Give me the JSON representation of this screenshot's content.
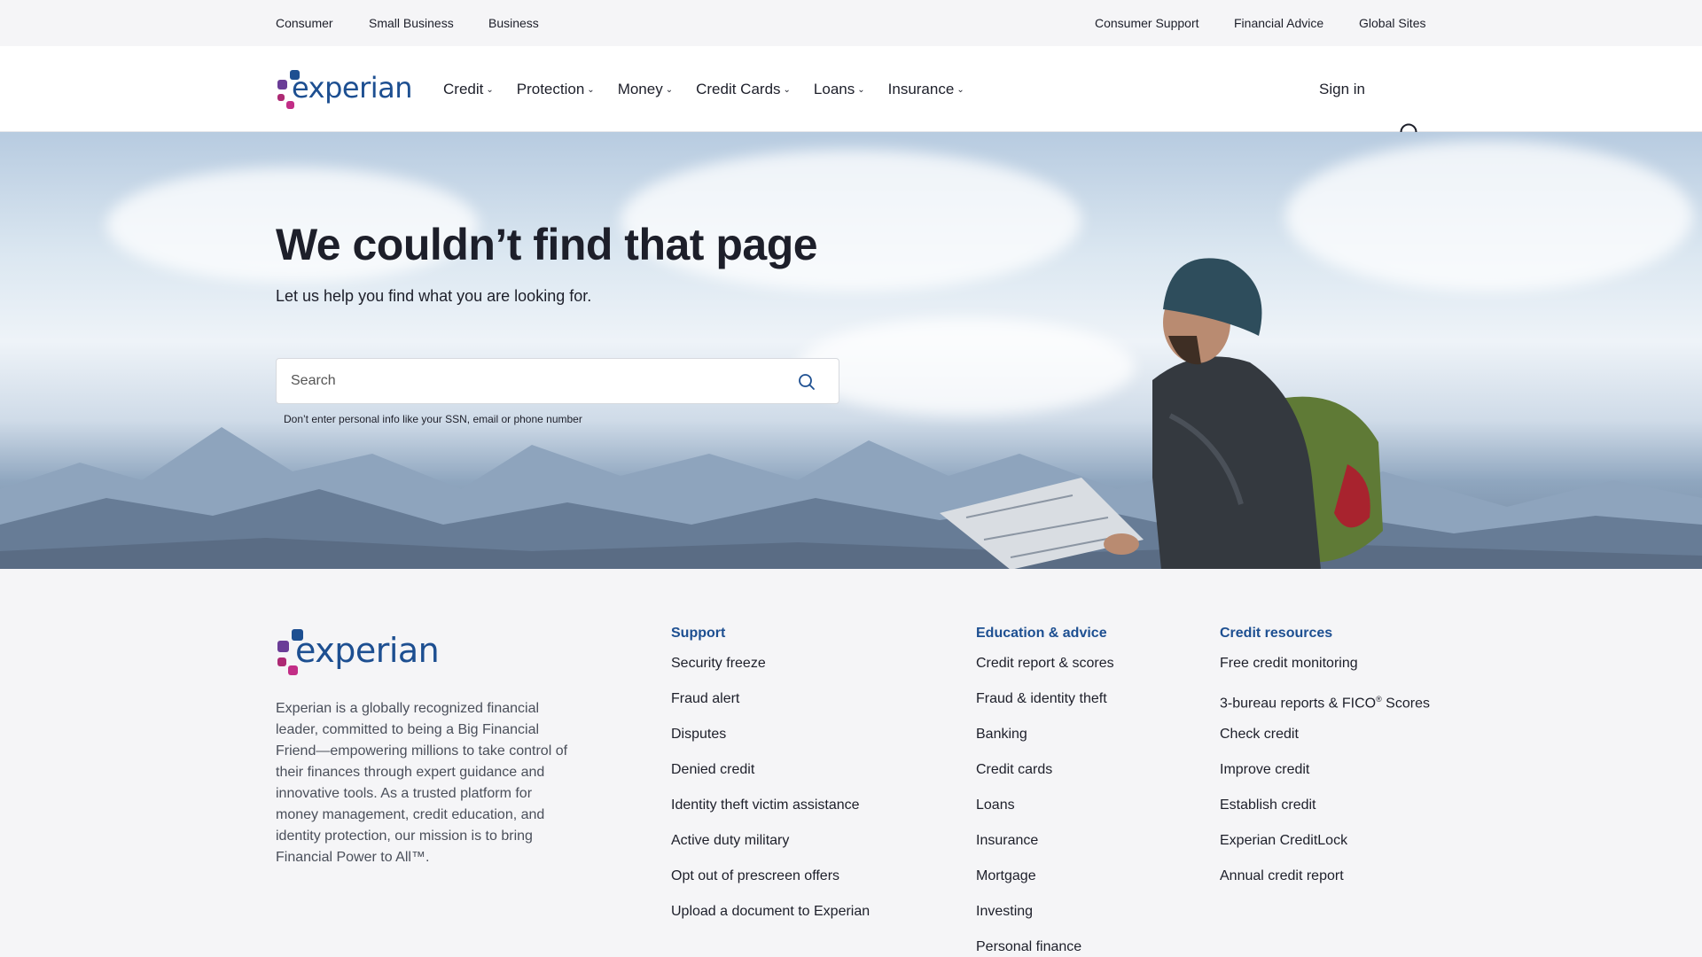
{
  "utility_left": [
    "Consumer",
    "Small Business",
    "Business"
  ],
  "utility_right": [
    "Consumer Support",
    "Financial Advice",
    "Global Sites"
  ],
  "brand": {
    "name": "experian",
    "color": "#1d4f91",
    "dot_colors": [
      "#6a3d97",
      "#1d4f91",
      "#c22d86",
      "#ad2a74"
    ]
  },
  "nav": {
    "items": [
      "Credit",
      "Protection",
      "Money",
      "Credit Cards",
      "Loans",
      "Insurance"
    ],
    "signin": "Sign in",
    "search_icon": "search-icon"
  },
  "hero": {
    "title": "We couldn’t find that page",
    "subtitle": "Let us help you find what you are looking for.",
    "search_placeholder": "Search",
    "hint": "Don’t enter personal info like your SSN, email or phone number"
  },
  "footer": {
    "about": "Experian is a globally recognized financial leader, committed to being a Big Financial Friend—empowering millions to take control of their finances through expert guidance and innovative tools. As a trusted platform for money management, credit education, and identity protection, our mission is to bring Financial Power to All™.",
    "support": {
      "title": "Support",
      "links": [
        "Security freeze",
        "Fraud alert",
        "Disputes",
        "Denied credit",
        "Identity theft victim assistance",
        "Active duty military",
        "Opt out of prescreen offers",
        "Upload a document to Experian"
      ]
    },
    "education": {
      "title": "Education & advice",
      "links": [
        "Credit report & scores",
        "Fraud & identity theft",
        "Banking",
        "Credit cards",
        "Loans",
        "Insurance",
        "Mortgage",
        "Investing",
        "Personal finance"
      ]
    },
    "resources": {
      "title": "Credit resources",
      "links": [
        "Free credit monitoring",
        "3-bureau reports & FICO",
        "Check credit",
        "Improve credit",
        "Establish credit",
        "Experian CreditLock",
        "Annual credit report"
      ],
      "fico_suffix": "Scores",
      "registered_mark": "®"
    }
  }
}
